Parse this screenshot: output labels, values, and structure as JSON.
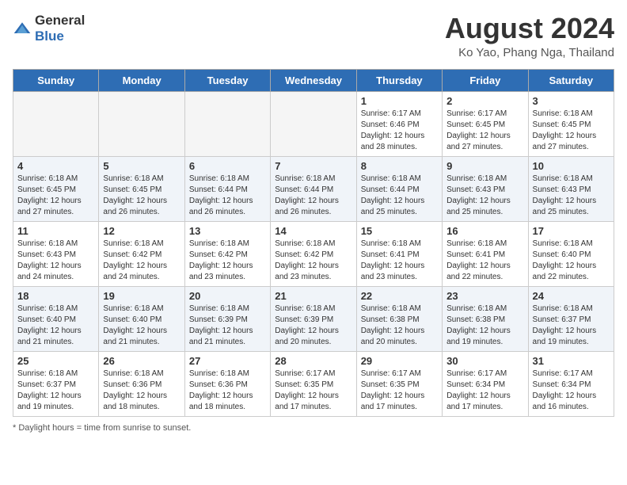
{
  "logo": {
    "general": "General",
    "blue": "Blue"
  },
  "title": "August 2024",
  "subtitle": "Ko Yao, Phang Nga, Thailand",
  "weekdays": [
    "Sunday",
    "Monday",
    "Tuesday",
    "Wednesday",
    "Thursday",
    "Friday",
    "Saturday"
  ],
  "footer": "Daylight hours",
  "weeks": [
    [
      {
        "day": "",
        "info": "",
        "empty": true
      },
      {
        "day": "",
        "info": "",
        "empty": true
      },
      {
        "day": "",
        "info": "",
        "empty": true
      },
      {
        "day": "",
        "info": "",
        "empty": true
      },
      {
        "day": "1",
        "info": "Sunrise: 6:17 AM\nSunset: 6:46 PM\nDaylight: 12 hours\nand 28 minutes."
      },
      {
        "day": "2",
        "info": "Sunrise: 6:17 AM\nSunset: 6:45 PM\nDaylight: 12 hours\nand 27 minutes."
      },
      {
        "day": "3",
        "info": "Sunrise: 6:18 AM\nSunset: 6:45 PM\nDaylight: 12 hours\nand 27 minutes."
      }
    ],
    [
      {
        "day": "4",
        "info": "Sunrise: 6:18 AM\nSunset: 6:45 PM\nDaylight: 12 hours\nand 27 minutes."
      },
      {
        "day": "5",
        "info": "Sunrise: 6:18 AM\nSunset: 6:45 PM\nDaylight: 12 hours\nand 26 minutes."
      },
      {
        "day": "6",
        "info": "Sunrise: 6:18 AM\nSunset: 6:44 PM\nDaylight: 12 hours\nand 26 minutes."
      },
      {
        "day": "7",
        "info": "Sunrise: 6:18 AM\nSunset: 6:44 PM\nDaylight: 12 hours\nand 26 minutes."
      },
      {
        "day": "8",
        "info": "Sunrise: 6:18 AM\nSunset: 6:44 PM\nDaylight: 12 hours\nand 25 minutes."
      },
      {
        "day": "9",
        "info": "Sunrise: 6:18 AM\nSunset: 6:43 PM\nDaylight: 12 hours\nand 25 minutes."
      },
      {
        "day": "10",
        "info": "Sunrise: 6:18 AM\nSunset: 6:43 PM\nDaylight: 12 hours\nand 25 minutes."
      }
    ],
    [
      {
        "day": "11",
        "info": "Sunrise: 6:18 AM\nSunset: 6:43 PM\nDaylight: 12 hours\nand 24 minutes."
      },
      {
        "day": "12",
        "info": "Sunrise: 6:18 AM\nSunset: 6:42 PM\nDaylight: 12 hours\nand 24 minutes."
      },
      {
        "day": "13",
        "info": "Sunrise: 6:18 AM\nSunset: 6:42 PM\nDaylight: 12 hours\nand 23 minutes."
      },
      {
        "day": "14",
        "info": "Sunrise: 6:18 AM\nSunset: 6:42 PM\nDaylight: 12 hours\nand 23 minutes."
      },
      {
        "day": "15",
        "info": "Sunrise: 6:18 AM\nSunset: 6:41 PM\nDaylight: 12 hours\nand 23 minutes."
      },
      {
        "day": "16",
        "info": "Sunrise: 6:18 AM\nSunset: 6:41 PM\nDaylight: 12 hours\nand 22 minutes."
      },
      {
        "day": "17",
        "info": "Sunrise: 6:18 AM\nSunset: 6:40 PM\nDaylight: 12 hours\nand 22 minutes."
      }
    ],
    [
      {
        "day": "18",
        "info": "Sunrise: 6:18 AM\nSunset: 6:40 PM\nDaylight: 12 hours\nand 21 minutes."
      },
      {
        "day": "19",
        "info": "Sunrise: 6:18 AM\nSunset: 6:40 PM\nDaylight: 12 hours\nand 21 minutes."
      },
      {
        "day": "20",
        "info": "Sunrise: 6:18 AM\nSunset: 6:39 PM\nDaylight: 12 hours\nand 21 minutes."
      },
      {
        "day": "21",
        "info": "Sunrise: 6:18 AM\nSunset: 6:39 PM\nDaylight: 12 hours\nand 20 minutes."
      },
      {
        "day": "22",
        "info": "Sunrise: 6:18 AM\nSunset: 6:38 PM\nDaylight: 12 hours\nand 20 minutes."
      },
      {
        "day": "23",
        "info": "Sunrise: 6:18 AM\nSunset: 6:38 PM\nDaylight: 12 hours\nand 19 minutes."
      },
      {
        "day": "24",
        "info": "Sunrise: 6:18 AM\nSunset: 6:37 PM\nDaylight: 12 hours\nand 19 minutes."
      }
    ],
    [
      {
        "day": "25",
        "info": "Sunrise: 6:18 AM\nSunset: 6:37 PM\nDaylight: 12 hours\nand 19 minutes."
      },
      {
        "day": "26",
        "info": "Sunrise: 6:18 AM\nSunset: 6:36 PM\nDaylight: 12 hours\nand 18 minutes."
      },
      {
        "day": "27",
        "info": "Sunrise: 6:18 AM\nSunset: 6:36 PM\nDaylight: 12 hours\nand 18 minutes."
      },
      {
        "day": "28",
        "info": "Sunrise: 6:17 AM\nSunset: 6:35 PM\nDaylight: 12 hours\nand 17 minutes."
      },
      {
        "day": "29",
        "info": "Sunrise: 6:17 AM\nSunset: 6:35 PM\nDaylight: 12 hours\nand 17 minutes."
      },
      {
        "day": "30",
        "info": "Sunrise: 6:17 AM\nSunset: 6:34 PM\nDaylight: 12 hours\nand 17 minutes."
      },
      {
        "day": "31",
        "info": "Sunrise: 6:17 AM\nSunset: 6:34 PM\nDaylight: 12 hours\nand 16 minutes."
      }
    ]
  ]
}
